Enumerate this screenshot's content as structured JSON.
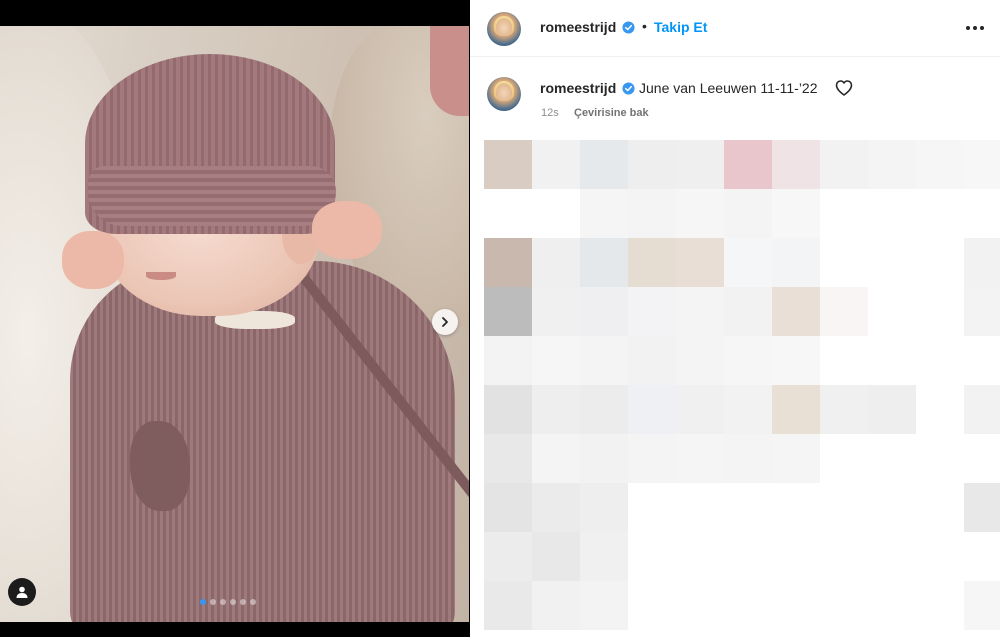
{
  "post": {
    "username": "romeestrijd",
    "follow_label": "Takip Et",
    "bullet": "•",
    "caption_username": "romeestrijd",
    "caption_text": "June van Leeuwen 11-11-’22",
    "time": "12s",
    "translate_label": "Çevirisine bak"
  },
  "media": {
    "dots_total": 6,
    "active_dot": 0
  },
  "colors": {
    "link_blue": "#0095f6",
    "verified_blue": "#3897f0",
    "muted_gray": "#8e8e8e"
  },
  "icons": [
    "verified-badge-icon",
    "more-options-icon",
    "heart-icon",
    "chevron-right-icon",
    "user-tag-icon"
  ]
}
